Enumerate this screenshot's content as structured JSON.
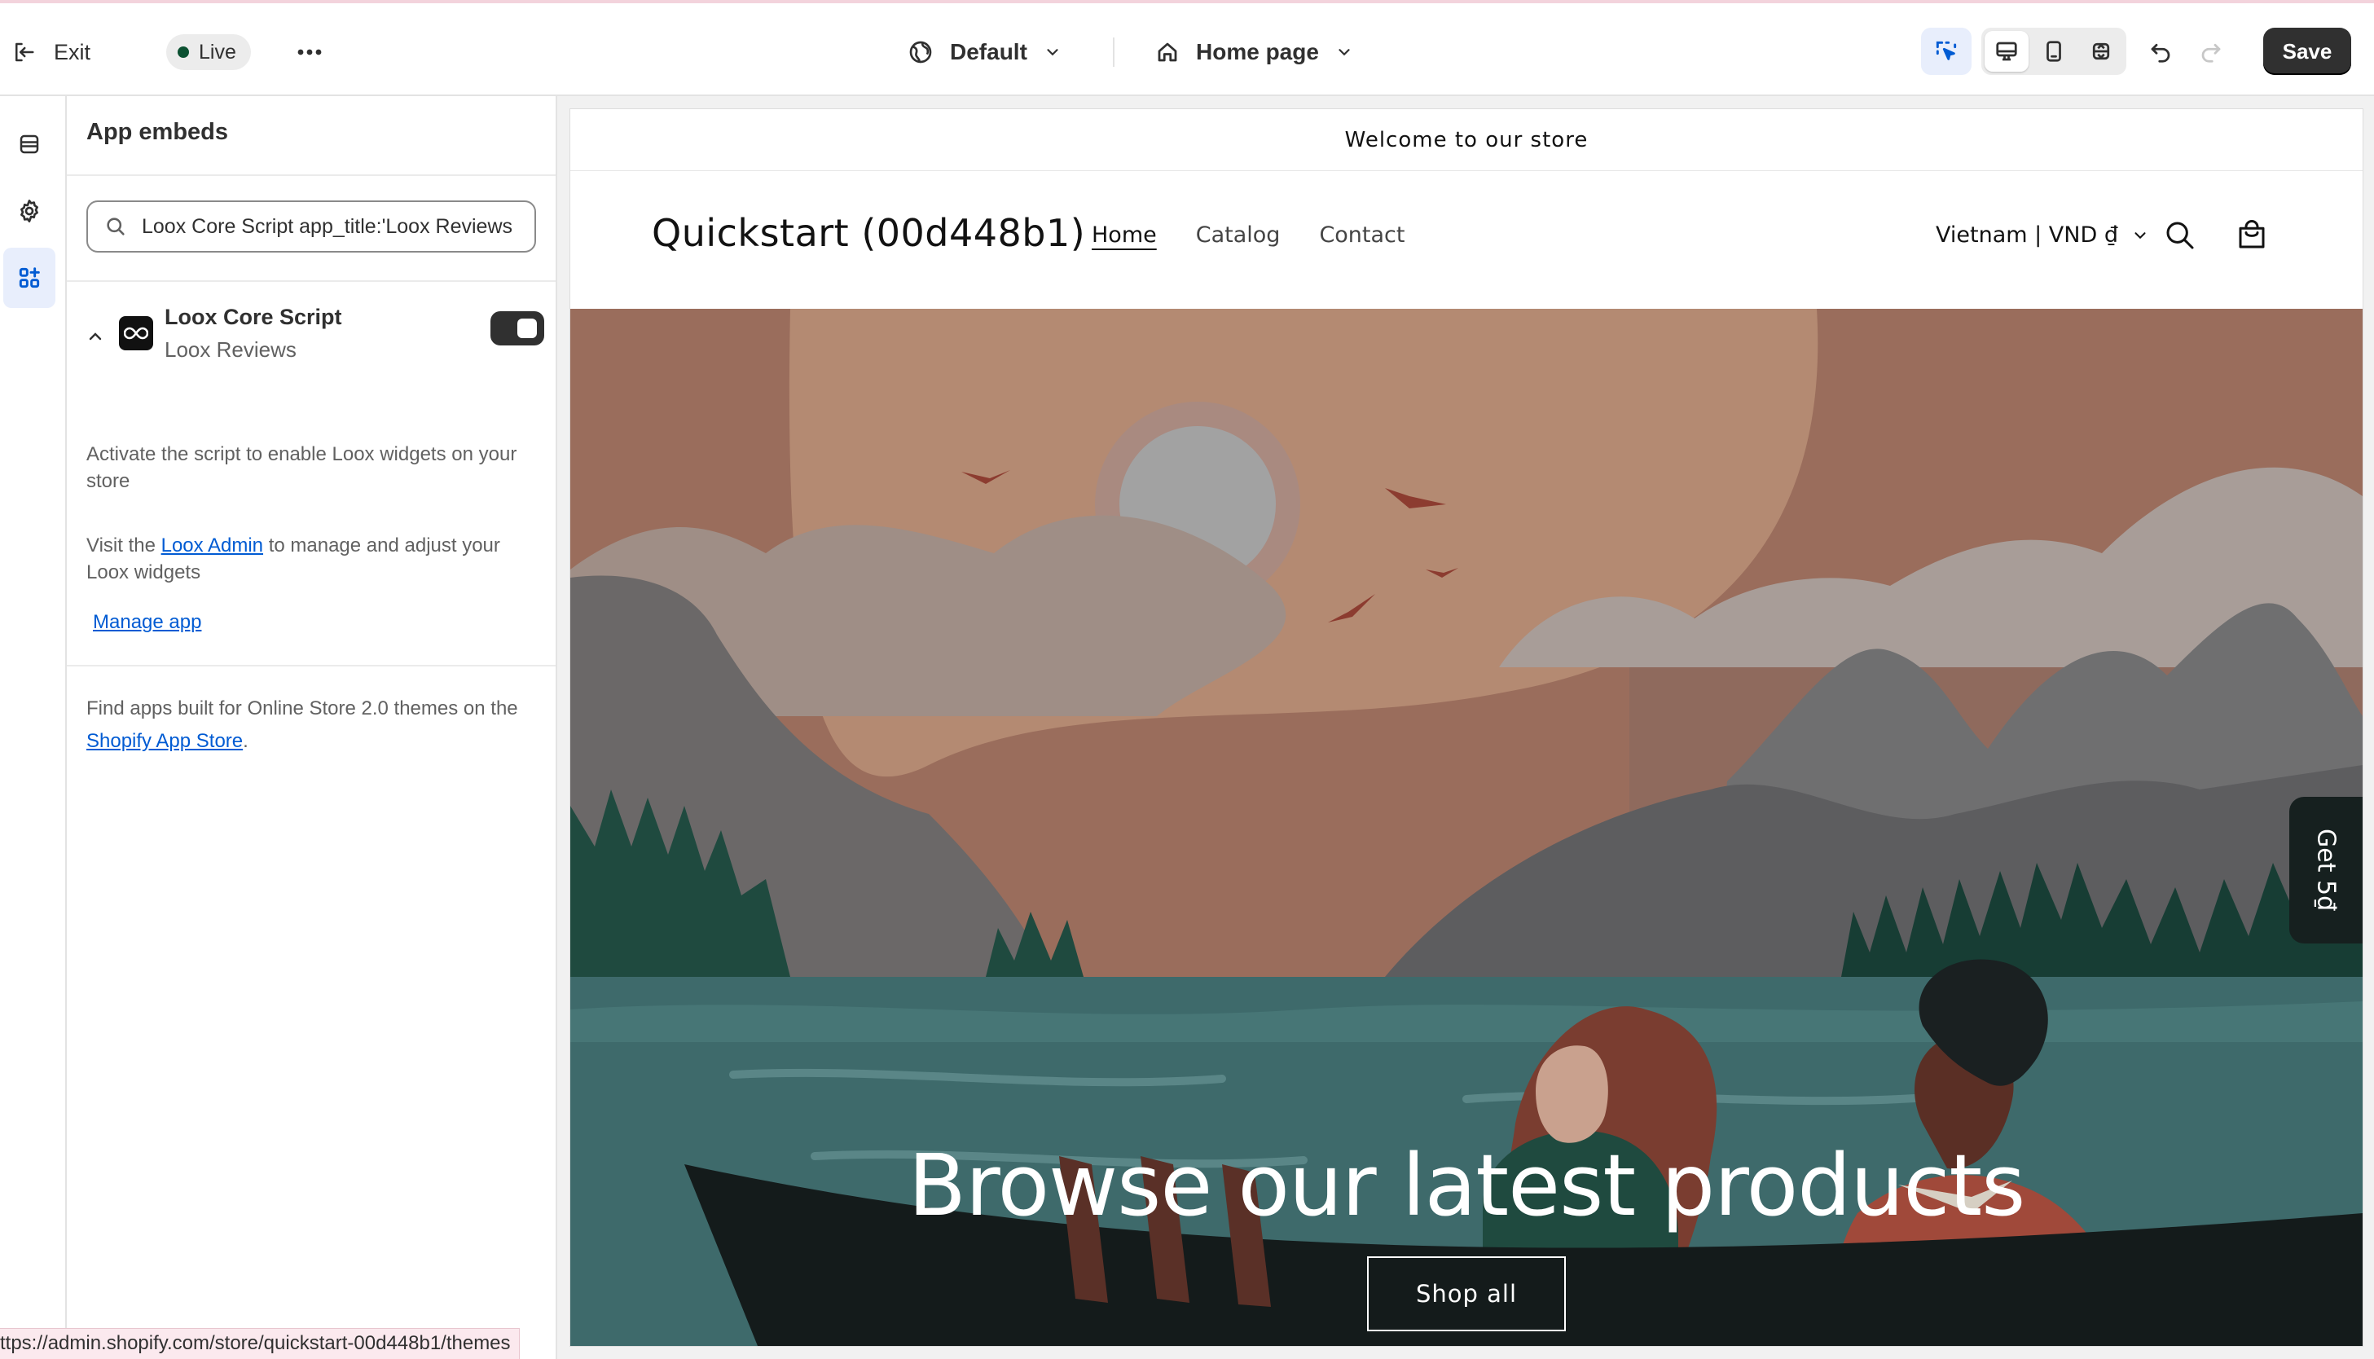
{
  "topbar": {
    "exit_label": "Exit",
    "live_label": "Live",
    "theme_label": "Default",
    "page_label": "Home page",
    "save_label": "Save"
  },
  "panel": {
    "title": "App embeds",
    "search_value": "Loox Core Script app_title:'Loox Reviews",
    "embed": {
      "name": "Loox Core Script",
      "app": "Loox Reviews",
      "enabled": true
    },
    "desc1": "Activate the script to enable Loox widgets on your store",
    "desc2_pre": "Visit the",
    "desc2_link": "Loox Admin",
    "desc2_post": "to manage and adjust your Loox widgets",
    "manage_link": "Manage app",
    "footer_pre": "Find apps built for Online Store 2.0 themes on the",
    "footer_link": "Shopify App Store",
    "footer_post": "."
  },
  "status_url": "ttps://admin.shopify.com/store/quickstart-00d448b1/themes",
  "store": {
    "announcement": "Welcome to our store",
    "name": "Quickstart (00d448b1)",
    "nav": [
      "Home",
      "Catalog",
      "Contact"
    ],
    "locale": "Vietnam | VND ₫",
    "hero_title": "Browse our latest products",
    "hero_button": "Shop all",
    "side_tab": "Get 5₫"
  },
  "colors": {
    "accent": "#005bd3",
    "save_bg": "#303030",
    "live_dot": "#0c5132"
  }
}
